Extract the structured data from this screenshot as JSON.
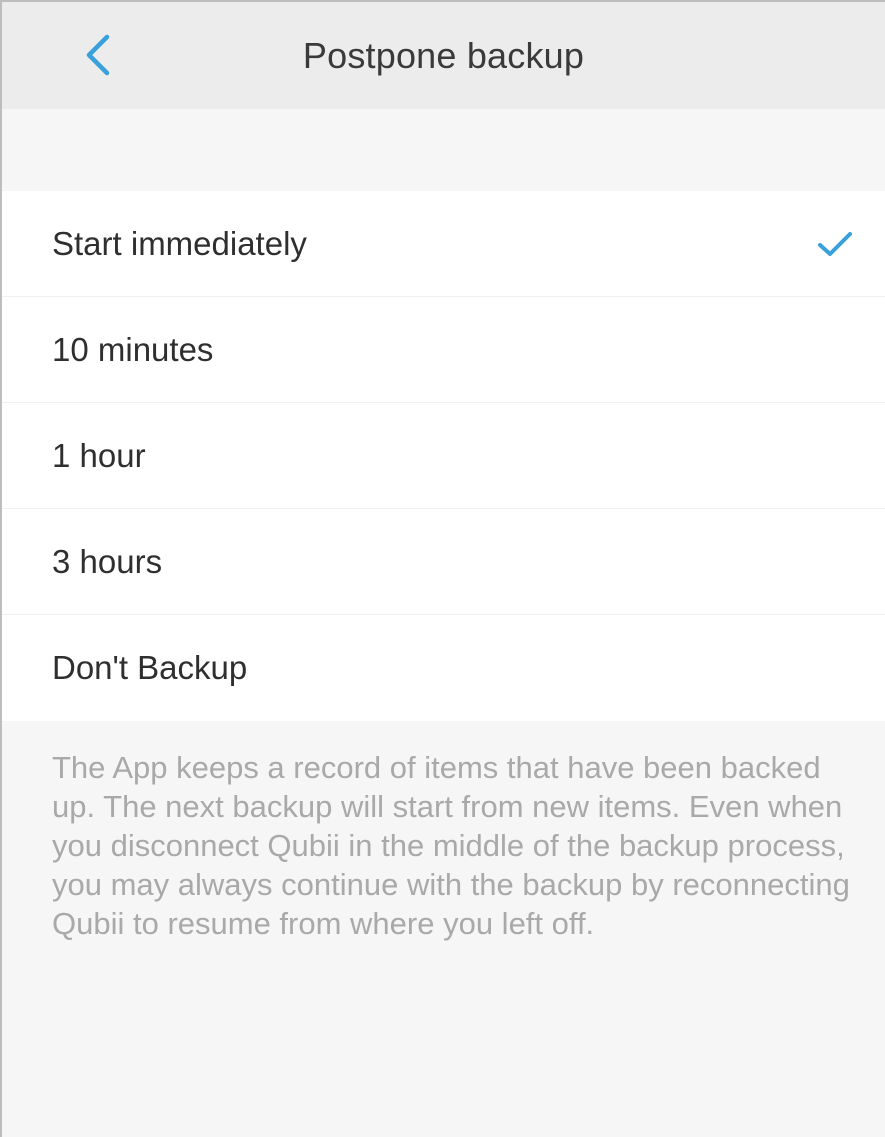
{
  "header": {
    "title": "Postpone backup",
    "back_icon": "chevron-left-icon"
  },
  "options": [
    {
      "label": "Start immediately",
      "selected": true
    },
    {
      "label": "10 minutes",
      "selected": false
    },
    {
      "label": "1 hour",
      "selected": false
    },
    {
      "label": "3 hours",
      "selected": false
    },
    {
      "label": "Don't Backup",
      "selected": false
    }
  ],
  "footnote": "The App keeps a record of items that have been backed up. The next backup will start from new items. Even when you disconnect Qubii in the middle of the backup process, you may always continue with the backup by reconnecting Qubii to resume from where you left off.",
  "colors": {
    "accent": "#3aa0dc",
    "nav_background": "#ececec",
    "page_background": "#f6f6f6",
    "footnote_text": "#a9a9a9"
  }
}
